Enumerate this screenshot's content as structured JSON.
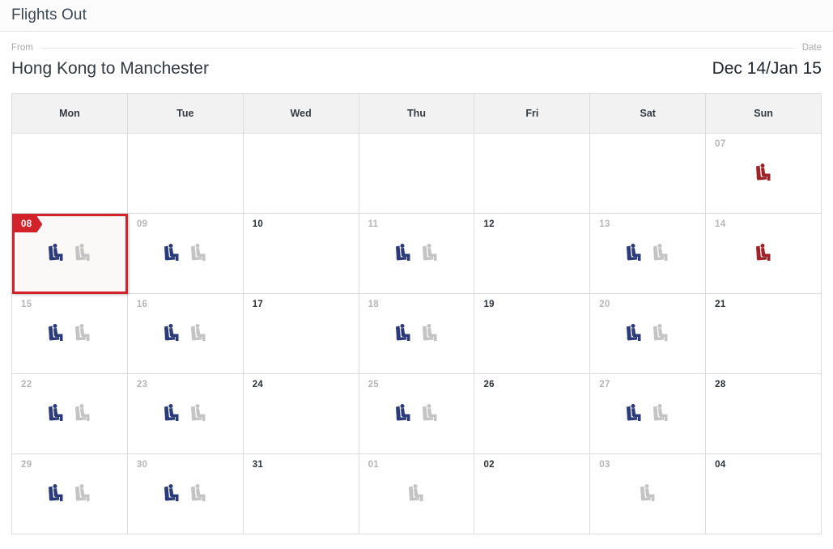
{
  "window": {
    "title": "Flights Out"
  },
  "header": {
    "from_label": "From",
    "date_label": "Date",
    "route": "Hong Kong to Manchester",
    "date_range": "Dec 14/Jan 15"
  },
  "colors": {
    "accent_red": "#d2232a",
    "seat_available": "#2b3a7a",
    "seat_unavailable": "#c4c4c4",
    "seat_premium": "#9e2227",
    "header_bg": "#f2f2f2",
    "grid_line": "#dcdcdc"
  },
  "calendar": {
    "weekdays": [
      "Mon",
      "Tue",
      "Wed",
      "Thu",
      "Fri",
      "Sat",
      "Sun"
    ],
    "selected_day": "08",
    "rows": [
      [
        {
          "day": "",
          "dim": true,
          "seats": []
        },
        {
          "day": "",
          "dim": true,
          "seats": []
        },
        {
          "day": "",
          "dim": true,
          "seats": []
        },
        {
          "day": "",
          "dim": true,
          "seats": []
        },
        {
          "day": "",
          "dim": true,
          "seats": []
        },
        {
          "day": "",
          "dim": true,
          "seats": []
        },
        {
          "day": "07",
          "dim": true,
          "seats": [
            "premium"
          ]
        }
      ],
      [
        {
          "day": "08",
          "dim": false,
          "selected": true,
          "seats": [
            "available",
            "unavailable"
          ]
        },
        {
          "day": "09",
          "dim": true,
          "seats": [
            "available",
            "unavailable"
          ]
        },
        {
          "day": "10",
          "dim": false,
          "seats": []
        },
        {
          "day": "11",
          "dim": true,
          "seats": [
            "available",
            "unavailable"
          ]
        },
        {
          "day": "12",
          "dim": false,
          "seats": []
        },
        {
          "day": "13",
          "dim": true,
          "seats": [
            "available",
            "unavailable"
          ]
        },
        {
          "day": "14",
          "dim": true,
          "seats": [
            "premium"
          ]
        }
      ],
      [
        {
          "day": "15",
          "dim": true,
          "seats": [
            "available",
            "unavailable"
          ]
        },
        {
          "day": "16",
          "dim": true,
          "seats": [
            "available",
            "unavailable"
          ]
        },
        {
          "day": "17",
          "dim": false,
          "seats": []
        },
        {
          "day": "18",
          "dim": true,
          "seats": [
            "available",
            "unavailable"
          ]
        },
        {
          "day": "19",
          "dim": false,
          "seats": []
        },
        {
          "day": "20",
          "dim": true,
          "seats": [
            "available",
            "unavailable"
          ]
        },
        {
          "day": "21",
          "dim": false,
          "seats": []
        }
      ],
      [
        {
          "day": "22",
          "dim": true,
          "seats": [
            "available",
            "unavailable"
          ]
        },
        {
          "day": "23",
          "dim": true,
          "seats": [
            "available",
            "unavailable"
          ]
        },
        {
          "day": "24",
          "dim": false,
          "seats": []
        },
        {
          "day": "25",
          "dim": true,
          "seats": [
            "available",
            "unavailable"
          ]
        },
        {
          "day": "26",
          "dim": false,
          "seats": []
        },
        {
          "day": "27",
          "dim": true,
          "seats": [
            "available",
            "unavailable"
          ]
        },
        {
          "day": "28",
          "dim": false,
          "seats": []
        }
      ],
      [
        {
          "day": "29",
          "dim": true,
          "seats": [
            "available",
            "unavailable"
          ]
        },
        {
          "day": "30",
          "dim": true,
          "seats": [
            "available",
            "unavailable"
          ]
        },
        {
          "day": "31",
          "dim": false,
          "seats": []
        },
        {
          "day": "01",
          "dim": true,
          "seats": [
            "unavailable"
          ]
        },
        {
          "day": "02",
          "dim": false,
          "seats": []
        },
        {
          "day": "03",
          "dim": true,
          "seats": [
            "unavailable"
          ]
        },
        {
          "day": "04",
          "dim": false,
          "seats": []
        }
      ]
    ]
  }
}
